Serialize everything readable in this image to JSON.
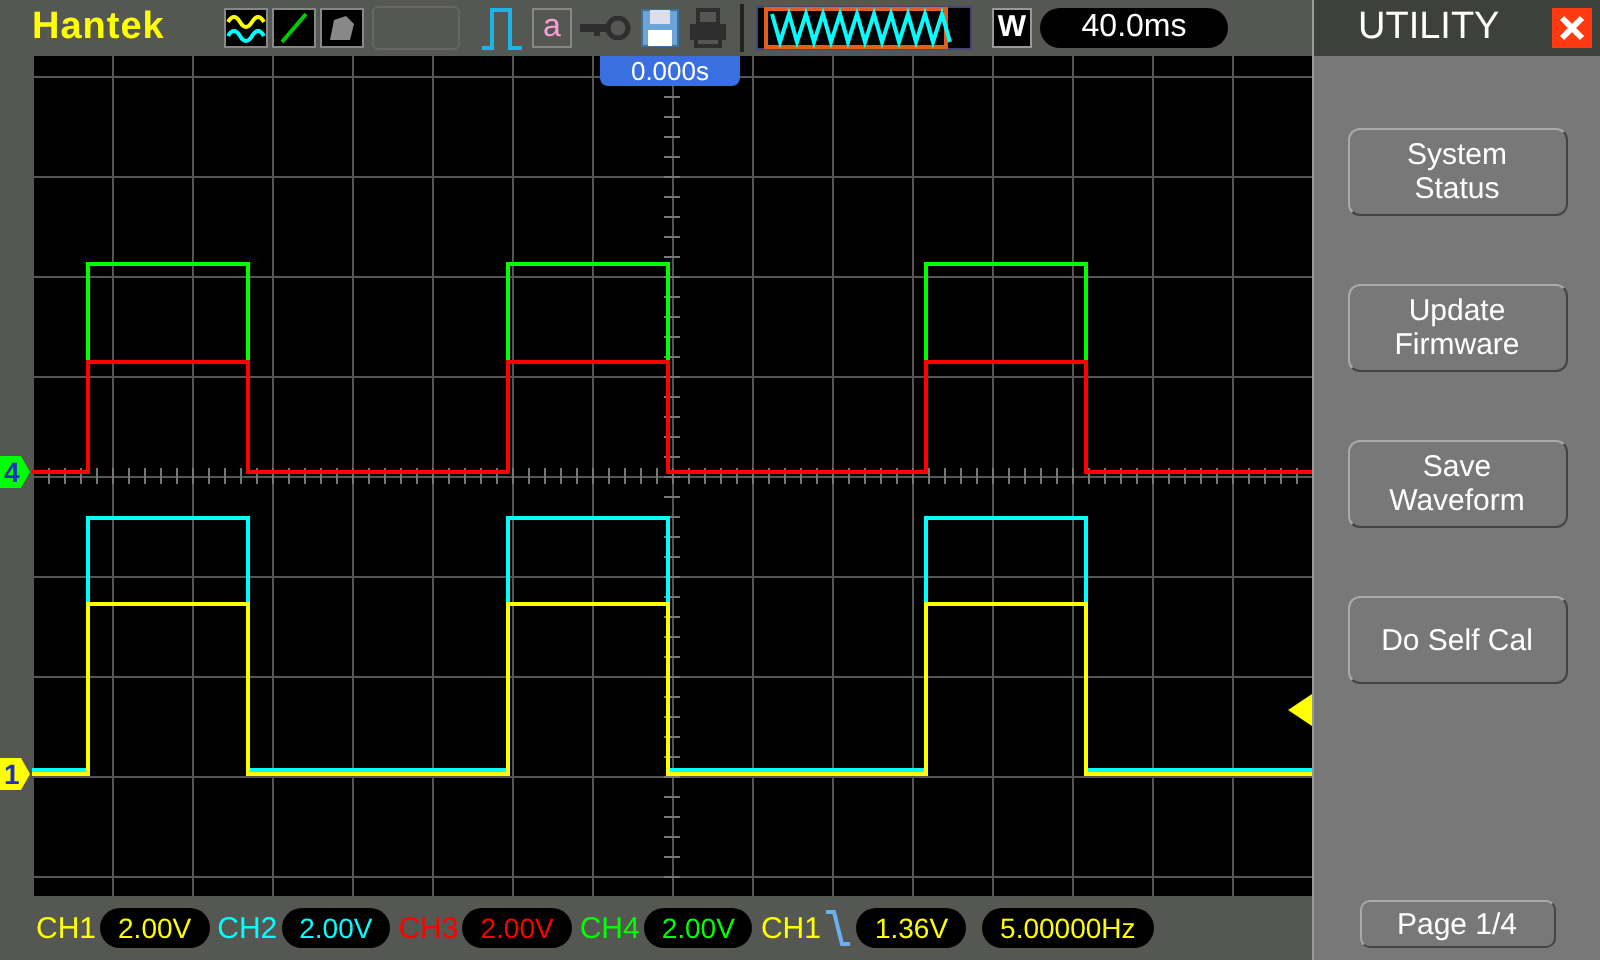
{
  "top_bar": {
    "logo": "Hantek",
    "math_label": "a",
    "zoom_mode": "W",
    "timebase": "40.0ms"
  },
  "screen": {
    "time_position": "0.000s",
    "markers": [
      {
        "label": "4",
        "color": "#00ff00"
      },
      {
        "label": "1",
        "color": "#ffff00"
      }
    ]
  },
  "channels": [
    {
      "name": "CH1",
      "scale": "2.00V",
      "color": "#ffff00"
    },
    {
      "name": "CH2",
      "scale": "2.00V",
      "color": "#00ffff"
    },
    {
      "name": "CH3",
      "scale": "2.00V",
      "color": "#ff0000"
    },
    {
      "name": "CH4",
      "scale": "2.00V",
      "color": "#00ff00"
    }
  ],
  "trigger": {
    "source": "CH1",
    "level": "1.36V",
    "frequency": "5.00000Hz"
  },
  "menu": {
    "title": "UTILITY",
    "buttons": [
      "System Status",
      "Update Firmware",
      "Save Waveform",
      "Do Self Cal"
    ],
    "page": "Page 1/4"
  }
}
